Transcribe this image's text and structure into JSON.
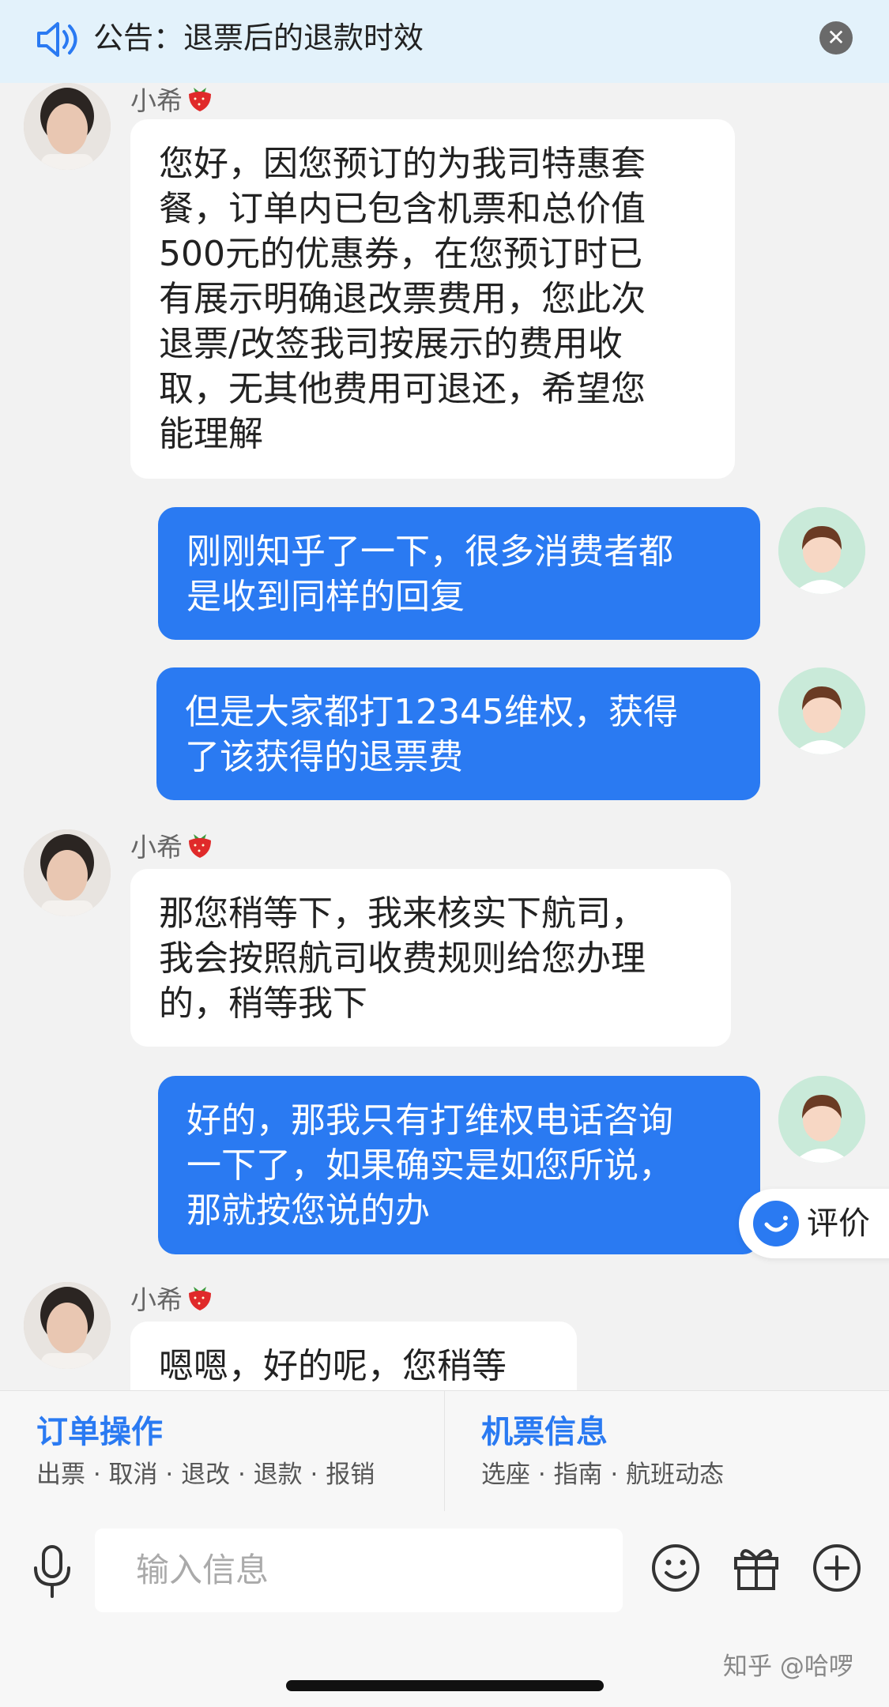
{
  "notice": {
    "text": "公告：退票后的退款时效",
    "close_icon": "close-icon"
  },
  "messages": [
    {
      "from": "agent",
      "sender": "小希",
      "text": "您好，因您预订的为我司特惠套\n餐，订单内已包含机票和总价值\n500元的优惠券，在您预订时已\n有展示明确退改票费用，您此次\n退票/改签我司按展示的费用收\n取，无其他费用可退还，希望您\n能理解"
    },
    {
      "from": "user",
      "text": "刚刚知乎了一下，很多消费者都\n是收到同样的回复"
    },
    {
      "from": "user",
      "text": "但是大家都打12345维权，获得\n了该获得的退票费"
    },
    {
      "from": "agent",
      "sender": "小希",
      "text": "那您稍等下，我来核实下航司，\n我会按照航司收费规则给您办理\n的，稍等我下"
    },
    {
      "from": "user",
      "text": "好的，那我只有打维权电话咨询\n一下了，如果确实是如您所说，\n那就按您说的办"
    },
    {
      "from": "agent",
      "sender": "小希",
      "text": "嗯嗯，好的呢，您稍等"
    }
  ],
  "rate_button": {
    "label": "评价"
  },
  "quick_actions": {
    "order": {
      "title": "订单操作",
      "sub": "出票 · 取消 · 退改 · 退款 · 报销"
    },
    "ticket": {
      "title": "机票信息",
      "sub": "选座 · 指南 · 航班动态"
    }
  },
  "input": {
    "placeholder": "输入信息"
  },
  "watermark": "知乎 @哈啰",
  "colors": {
    "accent": "#2a7af2",
    "notice_bg": "#e3f2fb",
    "chat_bg": "#f2f2f2"
  }
}
